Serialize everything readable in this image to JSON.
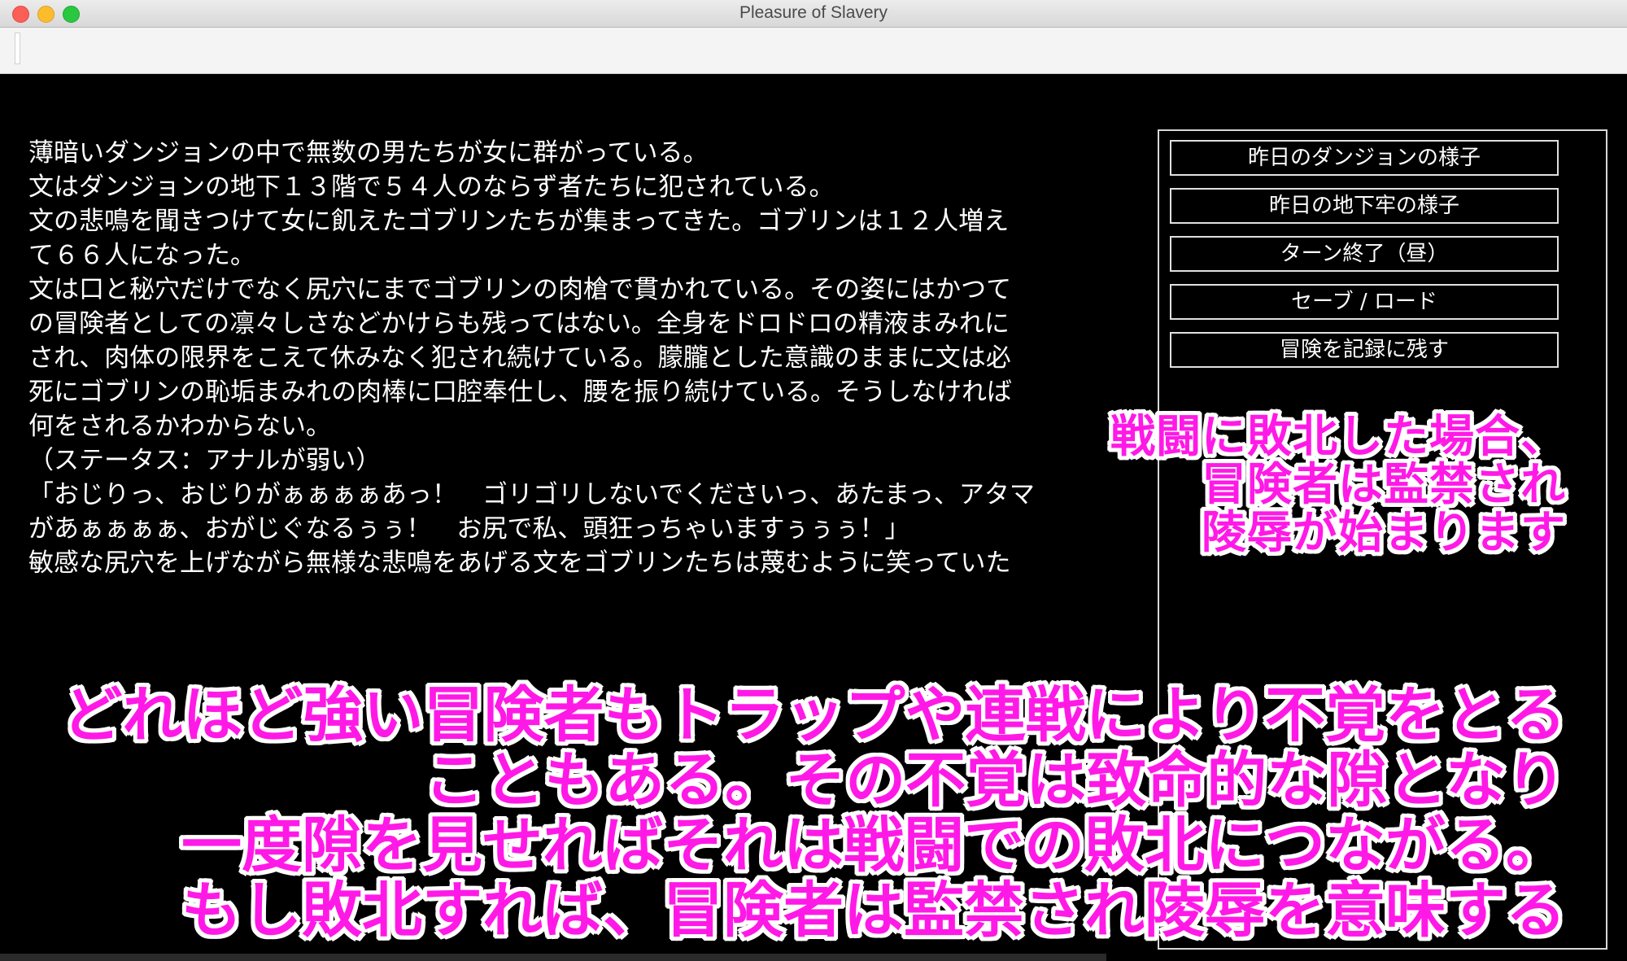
{
  "window": {
    "title": "Pleasure of Slavery"
  },
  "story": {
    "lines": [
      "薄暗いダンジョンの中で無数の男たちが女に群がっている。",
      "文はダンジョンの地下１３階で５４人のならず者たちに犯されている。",
      "文の悲鳴を聞きつけて女に飢えたゴブリンたちが集まってきた。ゴブリンは１２人増え",
      "て６６人になった。",
      "文は口と秘穴だけでなく尻穴にまでゴブリンの肉槍で貫かれている。その姿にはかつて",
      "の冒険者としての凛々しさなどかけらも残ってはない。全身をドロドロの精液まみれに",
      "され、肉体の限界をこえて休みなく犯され続けている。朦朧とした意識のままに文は必",
      "死にゴブリンの恥垢まみれの肉棒に口腔奉仕し、腰を振り続けている。そうしなければ",
      "何をされるかわからない。",
      "（ステータス：アナルが弱い）",
      "「おじりっ、おじりがぁぁぁぁあっ！　ゴリゴリしないでくださいっ、あたまっ、アタマ",
      "があぁぁぁぁ、おがじぐなるぅぅ！　お尻で私、頭狂っちゃいますぅぅぅ！」",
      "敏感な尻穴を上げながら無様な悲鳴をあげる文をゴブリンたちは蔑むように笑っていた"
    ]
  },
  "menu": {
    "buttons": [
      "昨日のダンジョンの様子",
      "昨日の地下牢の様子",
      "ターン終了（昼）",
      "セーブ / ロード",
      "冒険を記録に残す"
    ]
  },
  "promo": {
    "side_lines": [
      "戦闘に敗北した場合、",
      "冒険者は監禁され",
      "陵辱が始まります"
    ],
    "bottom_lines": [
      "どれほど強い冒険者もトラップや連戦により不覚をとる",
      "こともある。その不覚は致命的な隙となり",
      "一度隙を見せればそれは戦闘での敗北につながる。",
      "もし敗北すれば、冒険者は監禁され陵辱を意味する"
    ],
    "color": "#ff19e6"
  }
}
